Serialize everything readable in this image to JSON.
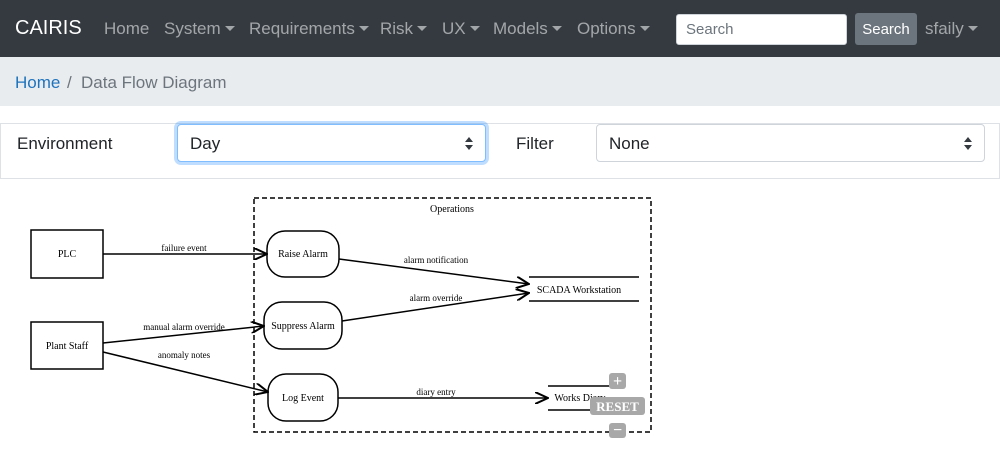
{
  "navbar": {
    "brand": "CAIRIS",
    "items": [
      {
        "label": "Home",
        "dropdown": false
      },
      {
        "label": "System",
        "dropdown": true
      },
      {
        "label": "Requirements",
        "dropdown": true
      },
      {
        "label": "Risk",
        "dropdown": true
      },
      {
        "label": "UX",
        "dropdown": true
      },
      {
        "label": "Models",
        "dropdown": true
      },
      {
        "label": "Options",
        "dropdown": true
      }
    ],
    "search_placeholder": "Search",
    "search_button": "Search",
    "user": "sfaily"
  },
  "breadcrumb": {
    "home": "Home",
    "separator": "/",
    "current": "Data Flow Diagram"
  },
  "filters": {
    "environment_label": "Environment",
    "environment_value": "Day",
    "filter_label": "Filter",
    "filter_value": "None"
  },
  "diagram": {
    "boundary_label": "Operations",
    "entities": {
      "plc": "PLC",
      "plant_staff": "Plant Staff"
    },
    "processes": {
      "raise_alarm": "Raise Alarm",
      "suppress_alarm": "Suppress Alarm",
      "log_event": "Log Event"
    },
    "datastores": {
      "scada": "SCADA Workstation",
      "works_diary": "Works Diary"
    },
    "flows": {
      "failure_event": "failure event",
      "alarm_notification": "alarm notification",
      "alarm_override": "alarm override",
      "manual_alarm_override": "manual alarm override",
      "anomaly_notes": "anomaly notes",
      "diary_entry": "diary entry"
    },
    "controls": {
      "zoom_in": "+",
      "reset": "RESET",
      "zoom_out": "−"
    }
  },
  "colors": {
    "navbar_bg": "#343a40",
    "breadcrumb_bg": "#e9ecef",
    "link": "#1e73be",
    "focus_border": "#80bdff",
    "zoom_controls": "#a8a8a8"
  }
}
